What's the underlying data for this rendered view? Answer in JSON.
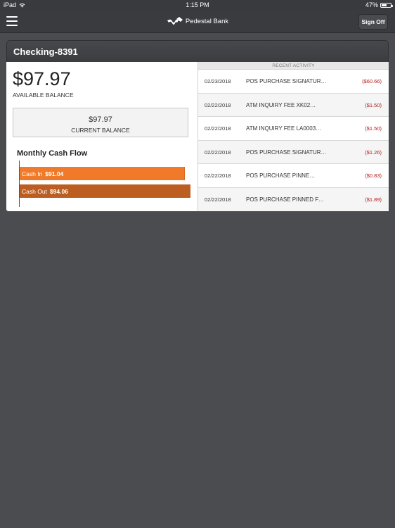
{
  "status_bar": {
    "device": "iPad",
    "time": "1:15 PM",
    "battery_text": "47%",
    "battery_level": 0.47
  },
  "nav": {
    "brand": "Pedestal Bank",
    "sign_off": "Sign Off"
  },
  "account": {
    "title": "Checking-8391",
    "available_balance": "$97.97",
    "available_label": "AVAILABLE BALANCE",
    "current_balance": "$97.97",
    "current_label": "CURRENT BALANCE"
  },
  "cash_flow": {
    "title": "Monthly Cash Flow",
    "in_label": "Cash In",
    "in_value": "$91.04",
    "in_amount": 91.04,
    "out_label": "Cash Out",
    "out_value": "$94.06",
    "out_amount": 94.06
  },
  "recent_activity": {
    "header": "RECENT ACTIVITY",
    "rows": [
      {
        "date": "02/23/2018",
        "desc": "POS PURCHASE SIGNATUR…",
        "amount": "($60.66)"
      },
      {
        "date": "02/22/2018",
        "desc": "ATM INQUIRY FEE XK02…",
        "amount": "($1.50)"
      },
      {
        "date": "02/22/2018",
        "desc": "ATM INQUIRY FEE LA0003…",
        "amount": "($1.50)"
      },
      {
        "date": "02/22/2018",
        "desc": "POS PURCHASE SIGNATUR…",
        "amount": "($1.26)"
      },
      {
        "date": "02/22/2018",
        "desc": "POS PURCHASE PINNE…",
        "amount": "($0.83)"
      },
      {
        "date": "02/22/2018",
        "desc": "POS PURCHASE PINNED F…",
        "amount": "($1.89)"
      }
    ]
  },
  "colors": {
    "cash_in": "#f07a29",
    "cash_out": "#bc5e22",
    "negative_amount": "#b01818"
  }
}
